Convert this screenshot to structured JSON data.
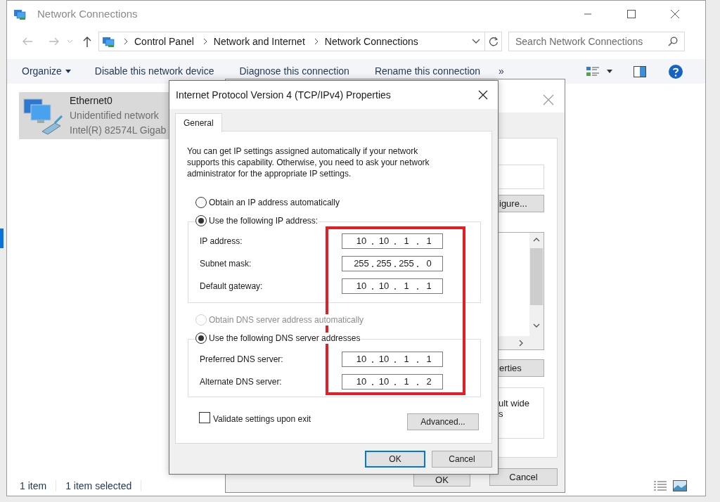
{
  "window": {
    "title": "Network Connections"
  },
  "address_bar": {
    "breadcrumbs": [
      "Control Panel",
      "Network and Internet",
      "Network Connections"
    ]
  },
  "search": {
    "placeholder": "Search Network Connections"
  },
  "toolbar": {
    "items": [
      {
        "label": "Organize",
        "kind": "menu"
      },
      {
        "label": "Disable this network device",
        "kind": "command"
      },
      {
        "label": "Diagnose this connection",
        "kind": "command"
      },
      {
        "label": "Rename this connection",
        "kind": "command"
      },
      {
        "label": "»",
        "kind": "overflow"
      }
    ]
  },
  "connections": [
    {
      "name": "Ethernet0",
      "status": "Unidentified network",
      "adapter": "Intel(R) 82574L Gigab",
      "selected": true
    }
  ],
  "status_bar": {
    "items": [
      "1 item",
      "1 item selected"
    ]
  },
  "background_dialog": {
    "configure_button": "igure...",
    "properties_button": "erties",
    "description": [
      "ult wide",
      "s"
    ],
    "buttons": [
      "OK",
      "Cancel"
    ]
  },
  "ipv4_dialog": {
    "title": "Internet Protocol Version 4 (TCP/IPv4) Properties",
    "tabs": [
      {
        "label": "General",
        "selected": true
      }
    ],
    "description": "You can get IP settings assigned automatically if your network supports this capability. Otherwise, you need to ask your network administrator for the appropriate IP settings.",
    "ip_mode": [
      {
        "label": "Obtain an IP address automatically",
        "selected": false,
        "disabled": false
      },
      {
        "label": "Use the following IP address:",
        "selected": true,
        "disabled": false
      }
    ],
    "ip_fields": [
      {
        "label": "IP address:",
        "octets": [
          "10",
          "10",
          "1",
          "1"
        ]
      },
      {
        "label": "Subnet mask:",
        "octets": [
          "255",
          "255",
          "255",
          "0"
        ]
      },
      {
        "label": "Default gateway:",
        "octets": [
          "10",
          "10",
          "1",
          "1"
        ]
      }
    ],
    "dns_mode": [
      {
        "label": "Obtain DNS server address automatically",
        "selected": false,
        "disabled": true
      },
      {
        "label": "Use the following DNS server addresses",
        "selected": true,
        "disabled": false
      }
    ],
    "dns_fields": [
      {
        "label": "Preferred DNS server:",
        "octets": [
          "10",
          "10",
          "1",
          "1"
        ]
      },
      {
        "label": "Alternate DNS server:",
        "octets": [
          "10",
          "10",
          "1",
          "2"
        ]
      }
    ],
    "validate": {
      "label": "Validate settings upon exit",
      "checked": false
    },
    "advanced_button": "Advanced...",
    "buttons": [
      {
        "label": "OK",
        "default": true
      },
      {
        "label": "Cancel",
        "default": false
      }
    ]
  }
}
